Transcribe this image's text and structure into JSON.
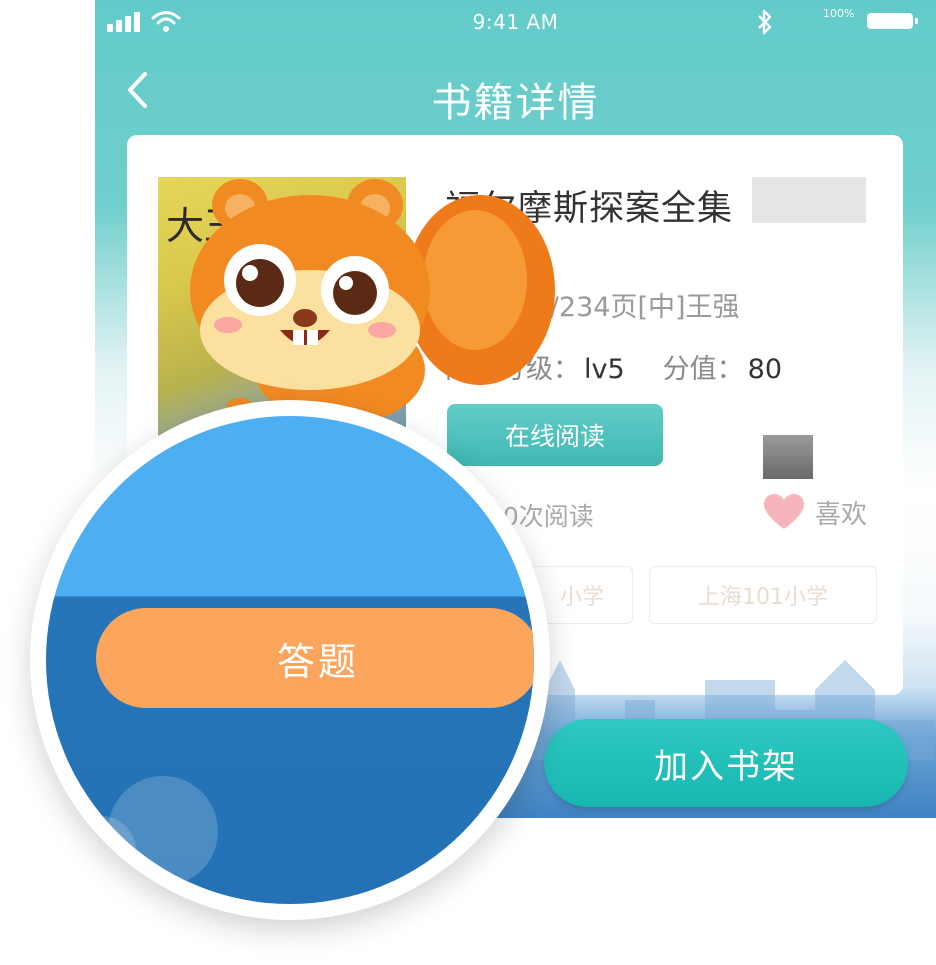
{
  "status_bar": {
    "time": "9:41 AM",
    "battery_percent": "100%"
  },
  "nav": {
    "title": "书籍详情",
    "back_icon": "chevron-left-icon"
  },
  "book": {
    "cover_text": "大王花",
    "title": "福尔摩斯探案全集",
    "meta": "强/2015/234页[中]王强",
    "grade_label": "阅读分级：",
    "grade_value": "lv5",
    "score_label": "分值：",
    "score_value": "80",
    "read_button": "在线阅读",
    "read_count": "00次阅读",
    "like_label": "喜欢"
  },
  "tags": [
    "小学",
    "上海101小学"
  ],
  "actions": {
    "add_shelf": "加入书架",
    "answer": "答题"
  },
  "colors": {
    "header_teal": "#62cbc9",
    "accent_teal": "#17b7b0",
    "answer_orange": "#fca55d",
    "magnifier_blue": "#2472b5",
    "like_pink": "#f6b4bd"
  }
}
